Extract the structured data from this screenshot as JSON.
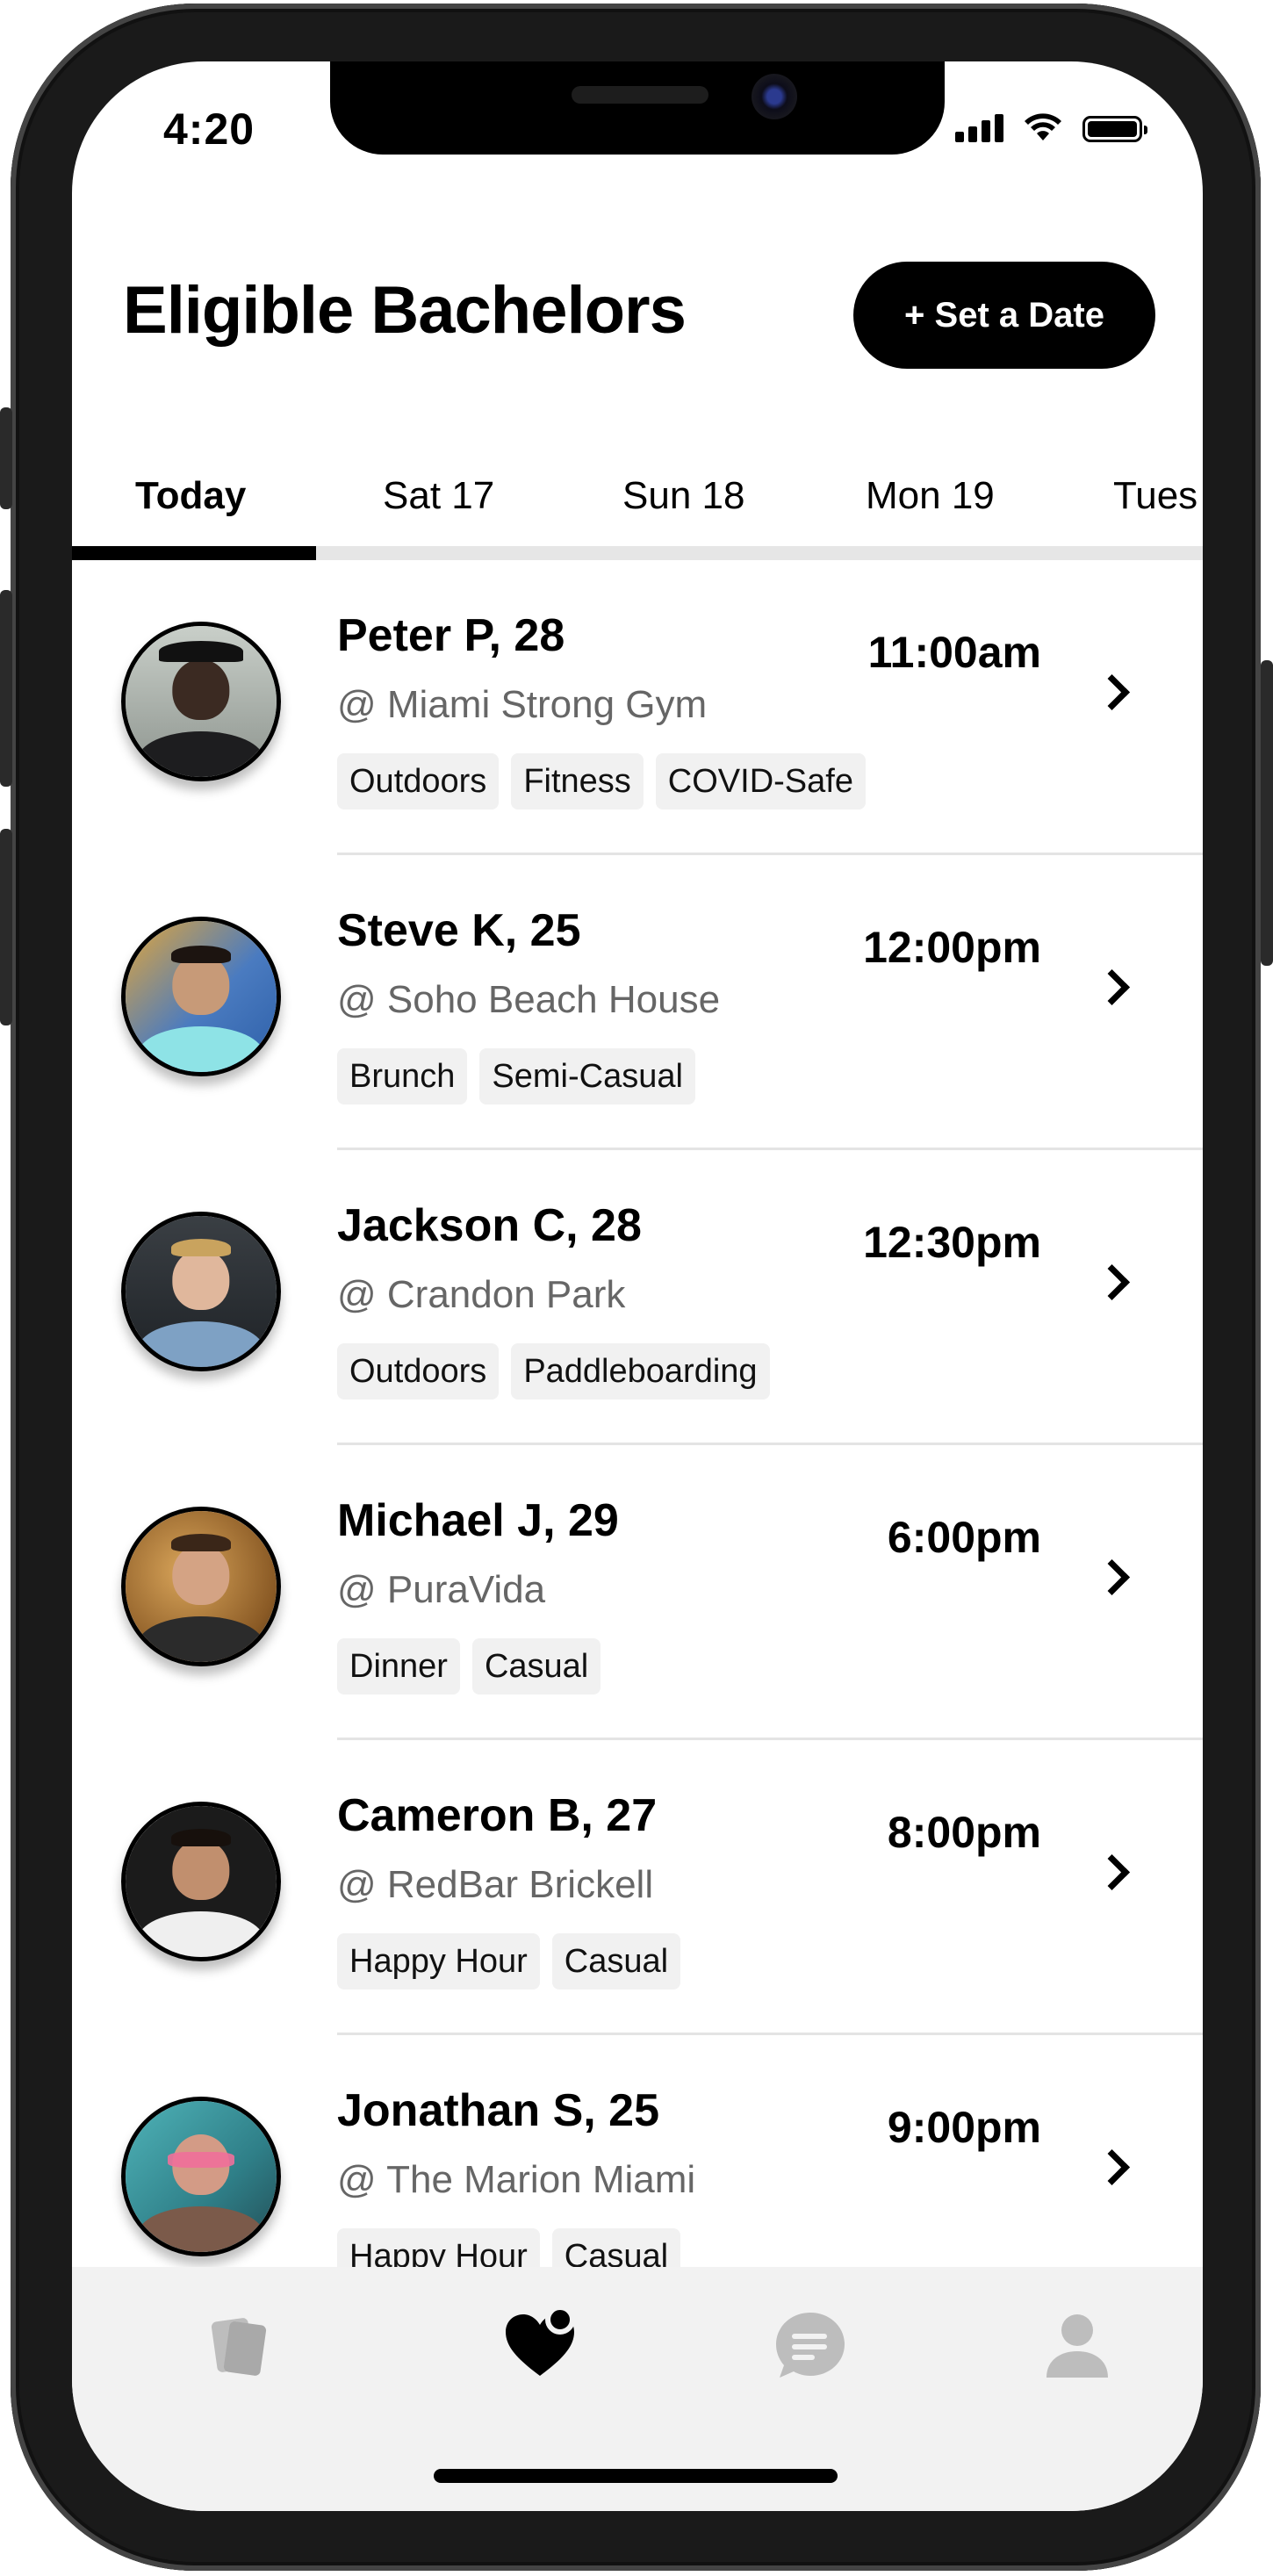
{
  "status_bar": {
    "time": "4:20"
  },
  "header": {
    "title": "Eligible Bachelors",
    "set_date_label": "+ Set a Date"
  },
  "tabs": [
    {
      "label": "Today",
      "active": true
    },
    {
      "label": "Sat 17",
      "active": false
    },
    {
      "label": "Sun 18",
      "active": false
    },
    {
      "label": "Mon 19",
      "active": false
    },
    {
      "label": "Tues",
      "active": false
    }
  ],
  "dates": [
    {
      "name": "Peter P, 28",
      "venue": "@ Miami Strong Gym",
      "time": "11:00am",
      "tags": [
        "Outdoors",
        "Fitness",
        "COVID-Safe"
      ],
      "avatar": "avatar-peter"
    },
    {
      "name": "Steve K, 25",
      "venue": "@ Soho Beach House",
      "time": "12:00pm",
      "tags": [
        "Brunch",
        "Semi-Casual"
      ],
      "avatar": "avatar-steve"
    },
    {
      "name": "Jackson C, 28",
      "venue": "@ Crandon Park",
      "time": "12:30pm",
      "tags": [
        "Outdoors",
        "Paddleboarding"
      ],
      "avatar": "avatar-jackson"
    },
    {
      "name": "Michael J, 29",
      "venue": "@ PuraVida",
      "time": "6:00pm",
      "tags": [
        "Dinner",
        "Casual"
      ],
      "avatar": "avatar-michael"
    },
    {
      "name": "Cameron B, 27",
      "venue": "@ RedBar Brickell",
      "time": "8:00pm",
      "tags": [
        "Happy Hour",
        "Casual"
      ],
      "avatar": "avatar-cameron"
    },
    {
      "name": "Jonathan S, 25",
      "venue": "@ The Marion Miami",
      "time": "9:00pm",
      "tags": [
        "Happy Hour",
        "Casual"
      ],
      "avatar": "avatar-jonathan"
    }
  ],
  "bottom_nav": [
    {
      "icon": "cards-icon",
      "active": false
    },
    {
      "icon": "heart-icon",
      "active": true
    },
    {
      "icon": "chat-icon",
      "active": false
    },
    {
      "icon": "profile-icon",
      "active": false
    }
  ],
  "colors": {
    "accent": "#000000",
    "muted_text": "#666666",
    "tag_bg": "#f1f1f1",
    "nav_bg": "#f2f2f2",
    "nav_inactive": "#bdbdbd"
  }
}
